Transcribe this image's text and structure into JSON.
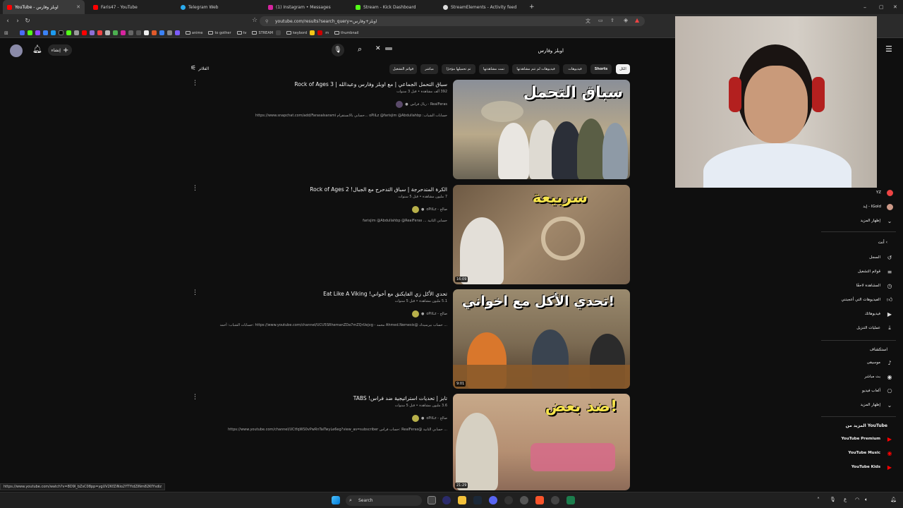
{
  "tabs": [
    {
      "title": "YouTube - اوبلز وفارس",
      "color": "#ff0000"
    },
    {
      "title": "Faris47 - YouTube",
      "color": "#ff0000"
    },
    {
      "title": "Telegram Web",
      "color": "#2aabee"
    },
    {
      "title": "(1) Instagram • Messages",
      "color": "#d6249f"
    },
    {
      "title": "Stream - Kick Dashboard",
      "color": "#53fc18"
    },
    {
      "title": "StreamElements - Activity feed",
      "color": "#dddddd"
    }
  ],
  "window_controls": {
    "minimize": "–",
    "maximize": "▢",
    "close": "✕",
    "new_tab": "+"
  },
  "url": "youtube.com/results?search_query=اوبلز+وفارس",
  "bookmarks": [
    "anime",
    "to gother",
    "tv",
    "STREAM",
    "keybord",
    "m",
    "thumbnail"
  ],
  "header": {
    "search_value": "اوبلز وفارس",
    "create_label": "إنشاء"
  },
  "filter_label": "الفلاتر",
  "chips": [
    "الكل",
    "Shorts",
    "فيديوهات",
    "فيديوهات لم تتم مشاهدتها",
    "تمت مشاهدتها",
    "تم تحميلها مؤخرًا",
    "مباشر",
    "قوائم التشغيل"
  ],
  "results": [
    {
      "title": "سباق التحمل الجماعي | مع اوبلز وفارس وعبدالله | Rock of Ages 3",
      "meta": "392 ألف مشاهدة • قبل 3 سنوات",
      "channel": "RealFeras - ريال فراس",
      "desc": "https://www.snapchat.com/add/Farasalsarami حسابي بالانستقرام... oPiiLz @farisjim @Abdullahbp :حسابات الشباب",
      "thumb_caption": "سباق التحمل",
      "duration": ""
    },
    {
      "title": "الكرة المتدحرجة | سباق التدحرج مع الجبال! Rock of Ages 2",
      "meta": "7 مليون مشاهدة • قبل 5 سنوات",
      "channel": "صالح - oPiiLz",
      "desc": "farisjim @Abdullahbp @RealFeras ... حسابي الثانية",
      "thumb_caption": "سرييعة",
      "duration": "16:09"
    },
    {
      "title": "تحدي الأكل زي الفايكنق مع أخواني! Eat Like A Viking",
      "meta": "5.1 مليون مشاهدة • قبل 5 سنوات",
      "channel": "صالح - oPiiLz",
      "desc": "حسابات الشباب: أحمد: https://www.youtube.com/channel/UCU5SRhemanZDa7mZQrUejvg - محمد Ahmed.Nemesis@ حساب بيرسيدك ...",
      "thumb_caption": "تحدي الأكل مع اخواني!",
      "duration": "9:01"
    },
    {
      "title": "تابز | تحديات استراتيجية ضد فراس! TABS",
      "meta": "3.6 مليون مشاهدة • قبل 5 سنوات",
      "channel": "صالح - oPiiLz",
      "desc": "https://www.youtube.com/channel/UCtfqWS0vPwRnTaiTwyLe6eg?view_as=subscriber حساب فراس: RealFeras@ حسابي الثانية ...",
      "thumb_caption": "ضد بعض!",
      "duration": "21:29"
    }
  ],
  "sidebar": {
    "subscriptions_tail": [
      "YZ",
      "إيد - IGold"
    ],
    "show_more": "إظهار المزيد",
    "you_label": "أنت",
    "you_items": [
      "السجل",
      "قوائم التشغيل",
      "المشاهدة لاحقًا",
      "الفيديوهات التي أعجبتني",
      "فيديوهاتك",
      "عمليات التنزيل"
    ],
    "explore_label": "استكشاف",
    "explore_items": [
      "موسيقى",
      "بث مباشر",
      "ألعاب فيديو",
      "إظهار المزيد"
    ],
    "more_from_label": "المزيد من YouTube",
    "more_items": [
      "YouTube Premium",
      "YouTube Music",
      "YouTube Kids"
    ]
  },
  "status_url": "https://www.youtube.com/watch?v=8D9I_bZsC08pp=ygUV2KfZiNio2YTYtdZiNm82KfYsdiz",
  "taskbar": {
    "search": "Search"
  },
  "colors": {
    "yt_red": "#ff0000",
    "bg": "#0f0f0f",
    "chip": "#272727"
  }
}
